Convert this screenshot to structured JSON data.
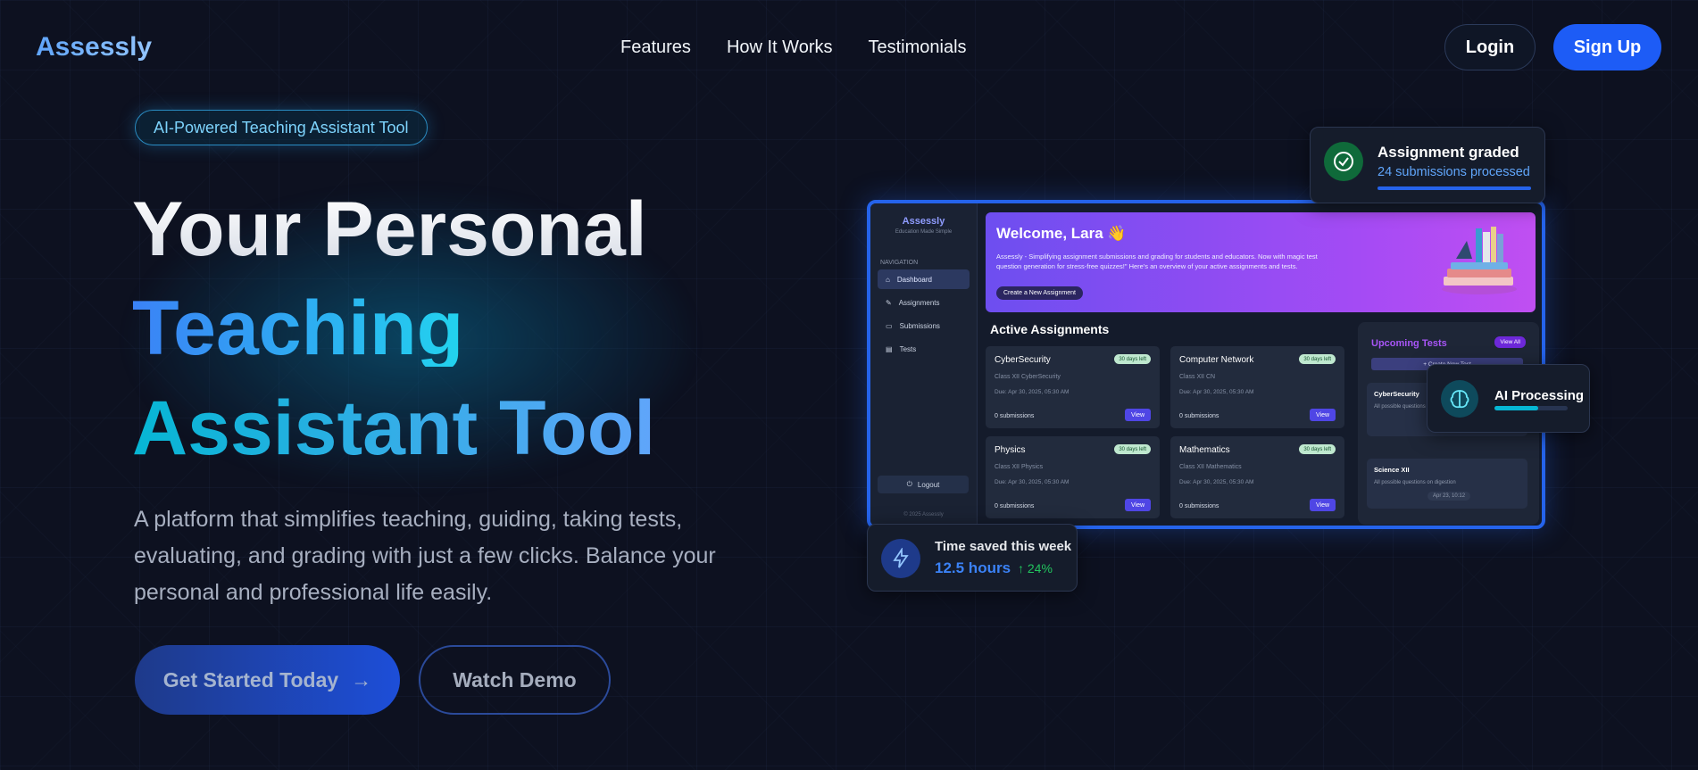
{
  "nav": {
    "logo": "Assessly",
    "links": [
      "Features",
      "How It Works",
      "Testimonials"
    ],
    "login": "Login",
    "signup": "Sign Up"
  },
  "hero": {
    "badge": "AI-Powered Teaching Assistant Tool",
    "title_line1": "Your Personal",
    "title_line2": "Teaching",
    "title_line3": "Assistant Tool",
    "subtitle": "A platform that simplifies teaching, guiding, taking tests, evaluating, and grading with just a few clicks. Balance your personal and professional life easily.",
    "cta_primary": "Get Started Today",
    "cta_primary_arrow": "→",
    "cta_secondary": "Watch Demo"
  },
  "dashboard": {
    "brand": "Assessly",
    "tagline": "Education Made Simple",
    "nav_heading": "NAVIGATION",
    "nav_items": [
      "Dashboard",
      "Assignments",
      "Submissions",
      "Tests"
    ],
    "logout": "Logout",
    "copyright": "© 2025 Assessly",
    "welcome": "Welcome, Lara 👋",
    "description": "Assessly - Simplifying assignment submissions and grading for students and educators. Now with magic test question generation for stress-free quizzes!\" Here's an overview of your active assignments and tests.",
    "create_assignment": "Create a New Assignment",
    "active_heading": "Active Assignments",
    "assignments": [
      {
        "name": "CyberSecurity",
        "class": "Class XII CyberSecurity",
        "due": "Due: Apr 30, 2025, 05:30 AM",
        "days": "30 days left",
        "subs": "0 submissions",
        "view": "View"
      },
      {
        "name": "Computer Network",
        "class": "Class XII CN",
        "due": "Due: Apr 30, 2025, 05:30 AM",
        "days": "30 days left",
        "subs": "0 submissions",
        "view": "View"
      },
      {
        "name": "Physics",
        "class": "Class XII Physics",
        "due": "Due: Apr 30, 2025, 05:30 AM",
        "days": "30 days left",
        "subs": "0 submissions",
        "view": "View"
      },
      {
        "name": "Mathematics",
        "class": "Class XII Mathematics",
        "due": "Due: Apr 30, 2025, 05:30 AM",
        "days": "30 days left",
        "subs": "0 submissions",
        "view": "View"
      }
    ],
    "upcoming_heading": "Upcoming Tests",
    "view_all": "View All",
    "create_test": "+ Create New Test",
    "tests": [
      {
        "name": "CyberSecurity",
        "q": "All possible questions"
      },
      {
        "name": "Science XII",
        "q": "All possible questions on digestion",
        "date": "Apr 23, 10:12"
      }
    ]
  },
  "floats": {
    "graded_title": "Assignment graded",
    "graded_sub": "24 submissions processed",
    "ai_title": "AI Processing",
    "ai_progress": 0.6,
    "time_title": "Time saved this week",
    "time_value": "12.5 hours",
    "time_change": "↑ 24%"
  },
  "colors": {
    "accent": "#1d5cf6",
    "cyan": "#06b6d4",
    "purple": "#a855f7",
    "green": "#22c55e"
  }
}
